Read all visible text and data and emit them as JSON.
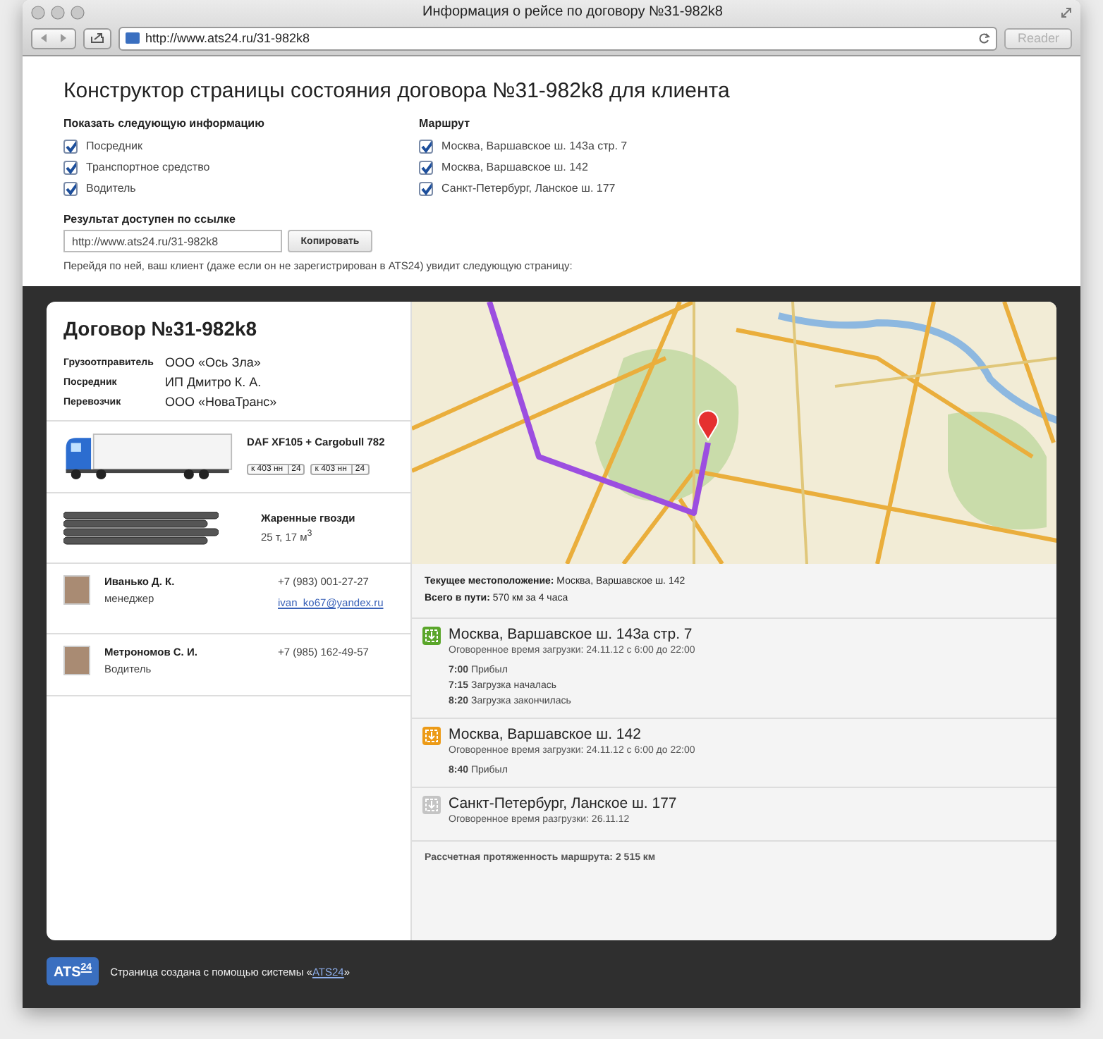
{
  "window": {
    "title": "Информация о рейсе по договору №31-982k8"
  },
  "toolbar": {
    "url": "http://www.ats24.ru/31-982k8",
    "reader": {
      "label": "Reader",
      "disabled": true
    }
  },
  "builder": {
    "title": "Конструктор страницы состояния договора №31-982k8 для клиента",
    "groups": [
      {
        "heading": "Показать следующую информацию",
        "options": [
          {
            "label": "Посредник",
            "checked": true
          },
          {
            "label": "Транспортное средство",
            "checked": true
          },
          {
            "label": "Водитель",
            "checked": true
          }
        ]
      },
      {
        "heading": "Маршрут",
        "options": [
          {
            "label": "Москва, Варшавское ш. 143а стр. 7",
            "checked": true
          },
          {
            "label": "Москва, Варшавское ш. 142",
            "checked": true
          },
          {
            "label": "Санкт-Петербург, Ланское ш. 177",
            "checked": true
          }
        ]
      }
    ],
    "link": {
      "label": "Результат доступен по ссылке",
      "value": "http://www.ats24.ru/31-982k8",
      "button": "Копировать"
    },
    "note": "Перейдя по ней, ваш клиент (даже если он не зарегистрирован в ATS24) увидит следующую страницу:"
  },
  "contract": {
    "title": "Договор №31-982k8",
    "parties": [
      {
        "label": "Грузоотправитель",
        "value": "ООО «Ось Зла»"
      },
      {
        "label": "Посредник",
        "value": "ИП Дмитро К. А."
      },
      {
        "label": "Перевозчик",
        "value": "ООО «НоваТранс»"
      }
    ],
    "vehicle": {
      "name": "DAF XF105 + Cargobull 782",
      "plates": [
        {
          "number": "к 403 нн",
          "region": "24"
        },
        {
          "number": "к 403 нн",
          "region": "24"
        }
      ]
    },
    "cargo": {
      "name": "Жаренные гвозди",
      "details": "25 т, 17 м$^{3}$"
    },
    "contacts": [
      {
        "name": "Иванько Д. К.",
        "role": "менеджер",
        "phone": "+7 (983) 001-27-27",
        "email": "ivan_ko67@yandex.ru"
      },
      {
        "name": "Метрономов С. И.",
        "role": "Водитель",
        "phone": "+7 (985) 162-49-57"
      }
    ]
  },
  "route": {
    "current": "**Текущее местоположение:** Москва, Варшавское ш. 142",
    "total": "**Всего в пути:** 570 км за 4 часа",
    "stops": [
      {
        "name": "Москва, Варшавское ш. 143а стр. 7",
        "color": "#5aa62a",
        "window": "Оговоренное время загрузки: 24.11.12 с 6:00 до 22:00",
        "events": [
          "**7:00** Прибыл",
          "**7:15** Загрузка началась",
          "**8:20** Загрузка закончилась"
        ]
      },
      {
        "name": "Москва, Варшавское ш. 142",
        "color": "#ec9a16",
        "window": "Оговоренное время загрузки: 24.11.12 с 6:00 до 22:00",
        "events": [
          "**8:40** Прибыл"
        ]
      },
      {
        "name": "Санкт-Петербург, Ланское ш. 177",
        "color": "#c4c4c4",
        "window": "Оговоренное время разгрузки: 26.11.12"
      }
    ],
    "estimate": "Рассчетная протяженность маршрута: 2 515 км"
  },
  "footer": {
    "logo": {
      "text": "ATS",
      "sup": "24"
    },
    "before": "Страница создана с помощью системы «",
    "link": "ATS24",
    "after": "»"
  }
}
